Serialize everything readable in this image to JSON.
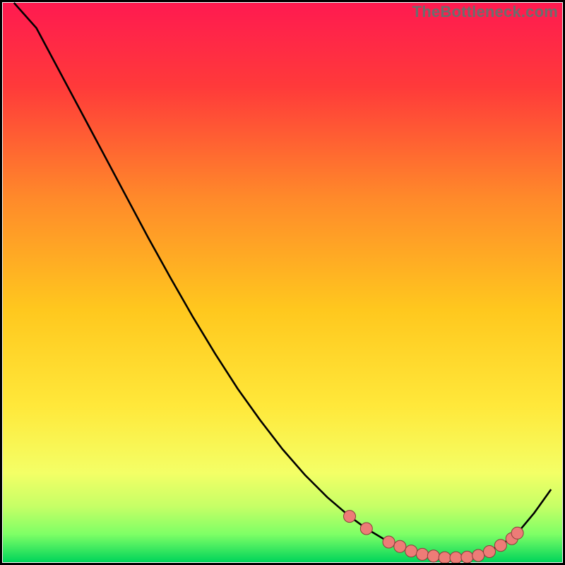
{
  "watermark": "TheBottleneck.com",
  "chart_data": {
    "type": "line",
    "title": "",
    "xlabel": "",
    "ylabel": "",
    "xlim": [
      0,
      100
    ],
    "ylim": [
      0,
      100
    ],
    "legend": false,
    "colors": {
      "line": "#000000",
      "marker_fill": "#ed7c77",
      "marker_stroke": "#8a3c3c",
      "border": "#000000",
      "gradient_top": "#ff1744",
      "gradient_mid": "#ffd600",
      "gradient_green": "#9cff57",
      "gradient_bottom": "#00c853"
    },
    "gradient_stops": [
      {
        "offset": 0.0,
        "color": "#ff1a50"
      },
      {
        "offset": 0.15,
        "color": "#ff3a3a"
      },
      {
        "offset": 0.35,
        "color": "#ff8a2a"
      },
      {
        "offset": 0.55,
        "color": "#ffc81e"
      },
      {
        "offset": 0.72,
        "color": "#ffe83a"
      },
      {
        "offset": 0.84,
        "color": "#f4ff66"
      },
      {
        "offset": 0.9,
        "color": "#c6ff66"
      },
      {
        "offset": 0.95,
        "color": "#7eff66"
      },
      {
        "offset": 1.0,
        "color": "#00d45a"
      }
    ],
    "x": [
      2,
      6,
      10,
      14,
      18,
      22,
      26,
      30,
      34,
      38,
      42,
      46,
      50,
      54,
      58,
      62,
      65,
      68,
      71,
      74,
      77,
      80,
      83,
      86,
      89,
      92,
      95,
      98
    ],
    "values": [
      100.0,
      95.5,
      88.0,
      80.5,
      73.0,
      65.5,
      58.0,
      50.8,
      43.8,
      37.2,
      31.0,
      25.4,
      20.2,
      15.6,
      11.6,
      8.2,
      6.0,
      4.2,
      2.8,
      1.8,
      1.1,
      0.7,
      0.9,
      1.6,
      3.0,
      5.2,
      8.8,
      13.0
    ],
    "markers": [
      {
        "x": 62,
        "y": 8.2
      },
      {
        "x": 65,
        "y": 6.0
      },
      {
        "x": 69,
        "y": 3.6
      },
      {
        "x": 71,
        "y": 2.8
      },
      {
        "x": 73,
        "y": 2.0
      },
      {
        "x": 75,
        "y": 1.4
      },
      {
        "x": 77,
        "y": 1.1
      },
      {
        "x": 79,
        "y": 0.8
      },
      {
        "x": 81,
        "y": 0.8
      },
      {
        "x": 83,
        "y": 0.9
      },
      {
        "x": 85,
        "y": 1.2
      },
      {
        "x": 87,
        "y": 1.9
      },
      {
        "x": 89,
        "y": 3.0
      },
      {
        "x": 91,
        "y": 4.2
      },
      {
        "x": 92,
        "y": 5.2
      }
    ]
  }
}
